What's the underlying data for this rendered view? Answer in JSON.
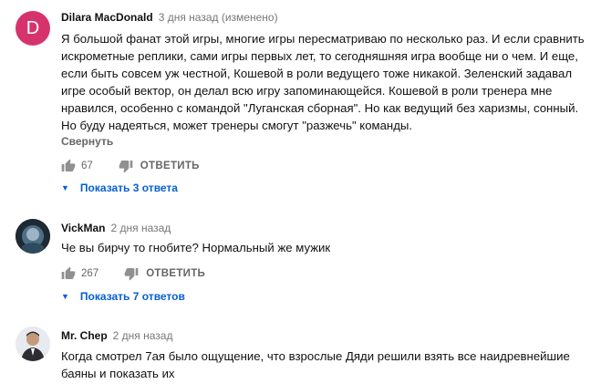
{
  "comments": [
    {
      "avatar_letter": "D",
      "author": "Dilara MacDonald",
      "time": "3 дня назад (изменено)",
      "text": "Я большой фанат этой игры, многие игры пересматриваю по несколько раз. И если сравнить\nискрометные реплики, сами игры первых лет, то сегодняшняя игра вообще ни о чем. И еще,\nесли быть совсем уж честной, Кошевой в роли ведущего тоже никакой. Зеленский задавал\nигре особый вектор, он делал всю игру запоминающейся. Кошевой в роли тренера мне\nнравился, особенно с командой \"Луганская сборная\". Но как ведущий без харизмы, сонный.\nНо буду надеяться, может тренеры смогут \"разжечь\" команды.",
      "collapse_label": "Свернуть",
      "likes": "67",
      "reply_label": "ОТВЕТИТЬ",
      "replies_label": "Показать 3 ответа"
    },
    {
      "author": "VickMan",
      "time": "2 дня назад",
      "text": "Че вы бирчу то гнобите? Нормальный же мужик",
      "likes": "267",
      "reply_label": "ОТВЕТИТЬ",
      "replies_label": "Показать 7 ответов"
    },
    {
      "author": "Mr. Chep",
      "time": "2 дня назад",
      "text": "Когда смотрел 7ая было ощущение, что взрослые Дяди решили взять все наидревнейшие\nбаяны и показать их"
    }
  ],
  "colors": {
    "link": "#065fd4",
    "avatar_d": "#d6336c",
    "muted": "#666666"
  }
}
